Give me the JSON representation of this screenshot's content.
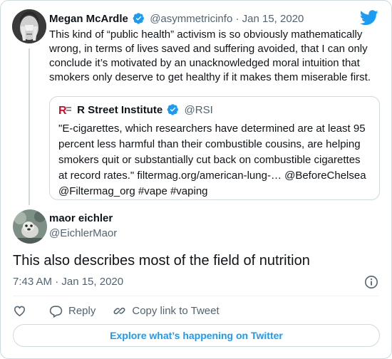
{
  "tweet": {
    "author_name": "Megan McArdle",
    "author_handle": "@asymmetricinfo",
    "separator": "·",
    "date": "Jan 15, 2020",
    "lines": [
      "This kind of “public health” activism is so obviously mathematically",
      "wrong, in terms of lives saved and suffering avoided, that I can only",
      "conclude it’s motivated by an unacknowledged moral intuition that",
      "smokers only deserve to get healthy if it makes them miserable first."
    ]
  },
  "quote": {
    "logo_text": "R",
    "author_name": "R Street Institute",
    "author_handle": "@RSI",
    "lines": [
      "\"E-cigarettes, which researchers have determined are at least 95",
      "percent less harmful than their combustible cousins, are helping",
      "smokers quit or substantially cut back on combustible cigarettes",
      "at record rates.\" filtermag.org/american-lung-… @BeforeChelsea",
      "@Filtermag_org #vape #vaping"
    ]
  },
  "reply": {
    "author_name": "maor eichler",
    "author_handle": "@EichlerMaor",
    "text": "This also describes most of the field of nutrition",
    "timestamp": "7:43 AM · Jan 15, 2020"
  },
  "actions": {
    "reply_label": "Reply",
    "copy_label": "Copy link to Tweet"
  },
  "explore_label": "Explore what’s happening on Twitter",
  "colors": {
    "accent": "#1d9bf0",
    "muted_text": "#536471",
    "border": "#cfd9de",
    "text": "#0f1419",
    "rsi_red": "#c8102e"
  },
  "icons": {
    "brand": "twitter-bird-icon",
    "verified": "verified-badge-icon",
    "info": "info-icon",
    "like": "heart-icon",
    "reply": "reply-icon",
    "copy": "link-icon"
  }
}
